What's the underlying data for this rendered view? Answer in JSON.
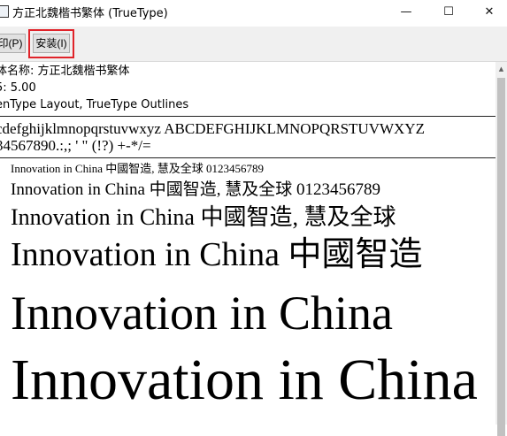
{
  "window": {
    "title": "方正北魏楷书繁体 (TrueType)",
    "minimize_glyph": "—",
    "maximize_glyph": "☐",
    "close_glyph": "✕"
  },
  "toolbar": {
    "print_label": "印(P)",
    "install_label": "安装(I)",
    "highlight_color": "#e0232a"
  },
  "font_info": {
    "name_line": "体名称: 方正北魏楷书繁体",
    "version_line": "5: 5.00",
    "type_line": "enType Layout, TrueType Outlines"
  },
  "character_set": {
    "line1": "cdefghijklmnopqrstuvwxyz ABCDEFGHIJKLMNOPQRSTUVWXYZ",
    "line2": "34567890.:,; ' \" (!?) +-*/="
  },
  "samples": [
    {
      "text": "Innovation in China 中國智造, 慧及全球 0123456789",
      "size": 12
    },
    {
      "text": "Innovation in China 中國智造, 慧及全球 0123456789",
      "size": 18
    },
    {
      "text": "Innovation in China 中國智造, 慧及全球",
      "size": 24
    },
    {
      "text": "Innovation in China 中國智造",
      "size": 36
    },
    {
      "text": "Innovation in China",
      "size": 48
    },
    {
      "text": "Innovation in China",
      "size": 60
    }
  ]
}
